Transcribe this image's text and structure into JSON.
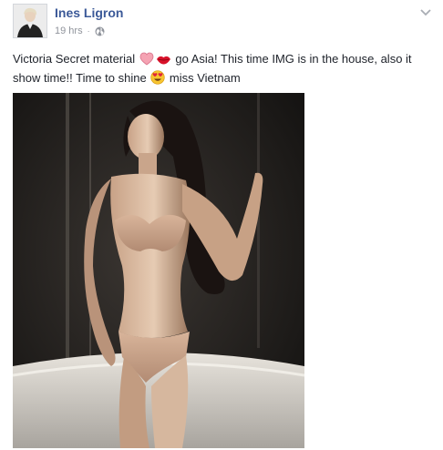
{
  "post": {
    "author": "Ines Ligron",
    "timestamp": "19 hrs",
    "visibility_icon": "globe-icon",
    "options_icon": "chevron-down-icon",
    "text_parts": [
      "Victoria Secret material ",
      " go Asia! This time IMG is in the house, also it show time!! Time to shine ",
      " miss Vietnam"
    ],
    "emojis": [
      "heart-icon",
      "kiss-lips-icon",
      "heart-eyes-icon"
    ],
    "image_content": "photo"
  },
  "colors": {
    "author_link": "#3b5998",
    "meta_gray": "#90949c",
    "body_text": "#1d2129",
    "heart_pink": "#f5a3b3"
  }
}
